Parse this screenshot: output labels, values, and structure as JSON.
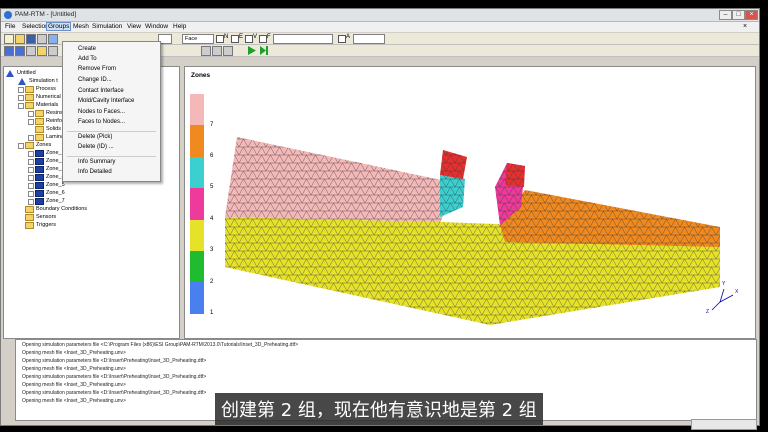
{
  "window": {
    "title": "PAM-RTM - [Untitled]"
  },
  "menubar": {
    "file": "File",
    "selection": "Selection",
    "groups": "Groups",
    "mesh": "Mesh",
    "simulation": "Simulation",
    "view": "View",
    "window": "Window",
    "help": "Help"
  },
  "toolbar": {
    "face_combo": "Face",
    "check_n": "N",
    "check_e": "E",
    "check_v": "V",
    "check_f": "F",
    "check_a": "A"
  },
  "groups_menu": [
    "Create",
    "Add To",
    "Remove From",
    "Change ID...",
    "Contact Interface",
    "Mold/Cavity Interface",
    "Nodes to Faces...",
    "Faces to Nodes...",
    "Delete (Pick)",
    "Delete (ID) ...",
    "Info Summary",
    "Info Detailed"
  ],
  "tree": {
    "root": "Untitled",
    "simulation": "Simulation t",
    "process": "Process",
    "numerical": "Numerical",
    "materials": "Materials",
    "resins": "Resins",
    "reinforcements": "Reinforc",
    "solids": "Solids",
    "laminates": "Laminat",
    "zones": "Zones",
    "zone_items": [
      "Zone_1",
      "Zone_2",
      "Zone_3",
      "Zone_4",
      "Zone_5",
      "Zone_6",
      "Zone_7"
    ],
    "boundary": "Boundary Conditions",
    "sensors": "Sensors",
    "triggers": "Triggers"
  },
  "viewport": {
    "title": "Zones",
    "legend": [
      {
        "label": "7",
        "color": "#f4b8b8"
      },
      {
        "label": "6",
        "color": "#f08a20"
      },
      {
        "label": "5",
        "color": "#3ccfcf"
      },
      {
        "label": "4",
        "color": "#ee3a9a"
      },
      {
        "label": "3",
        "color": "#e6e22a"
      },
      {
        "label": "2",
        "color": "#1ebc2e"
      },
      {
        "label": "1",
        "color": "#4a7ff0"
      }
    ],
    "axes": {
      "x": "X",
      "y": "Y",
      "z": "Z"
    }
  },
  "log": [
    "Opening simulation parameters file <C:\\Program Files (x86)\\ESI Group\\PAM-RTM\\2013.0\\Tutorials\\Inset_3D_Preheating.dtf>",
    "Opening mesh file <Inset_3D_Preheating.unv>",
    "Opening simulation parameters file <D:\\Insert\\Preheating\\Inset_3D_Preheating.dtf>",
    "Opening mesh file <Inset_3D_Preheating.unv>",
    "Opening simulation parameters file <D:\\Insert\\Preheating\\Inset_3D_Preheating.dtf>",
    "Opening mesh file <Inset_3D_Preheating.unv>",
    "Opening simulation parameters file <D:\\Insert\\Preheating\\Inset_3D_Preheating.dtf>",
    "Opening mesh file <Inset_3D_Preheating.unv>"
  ],
  "subtitle": "创建第 2 组，现在他有意识地是第 2 组"
}
